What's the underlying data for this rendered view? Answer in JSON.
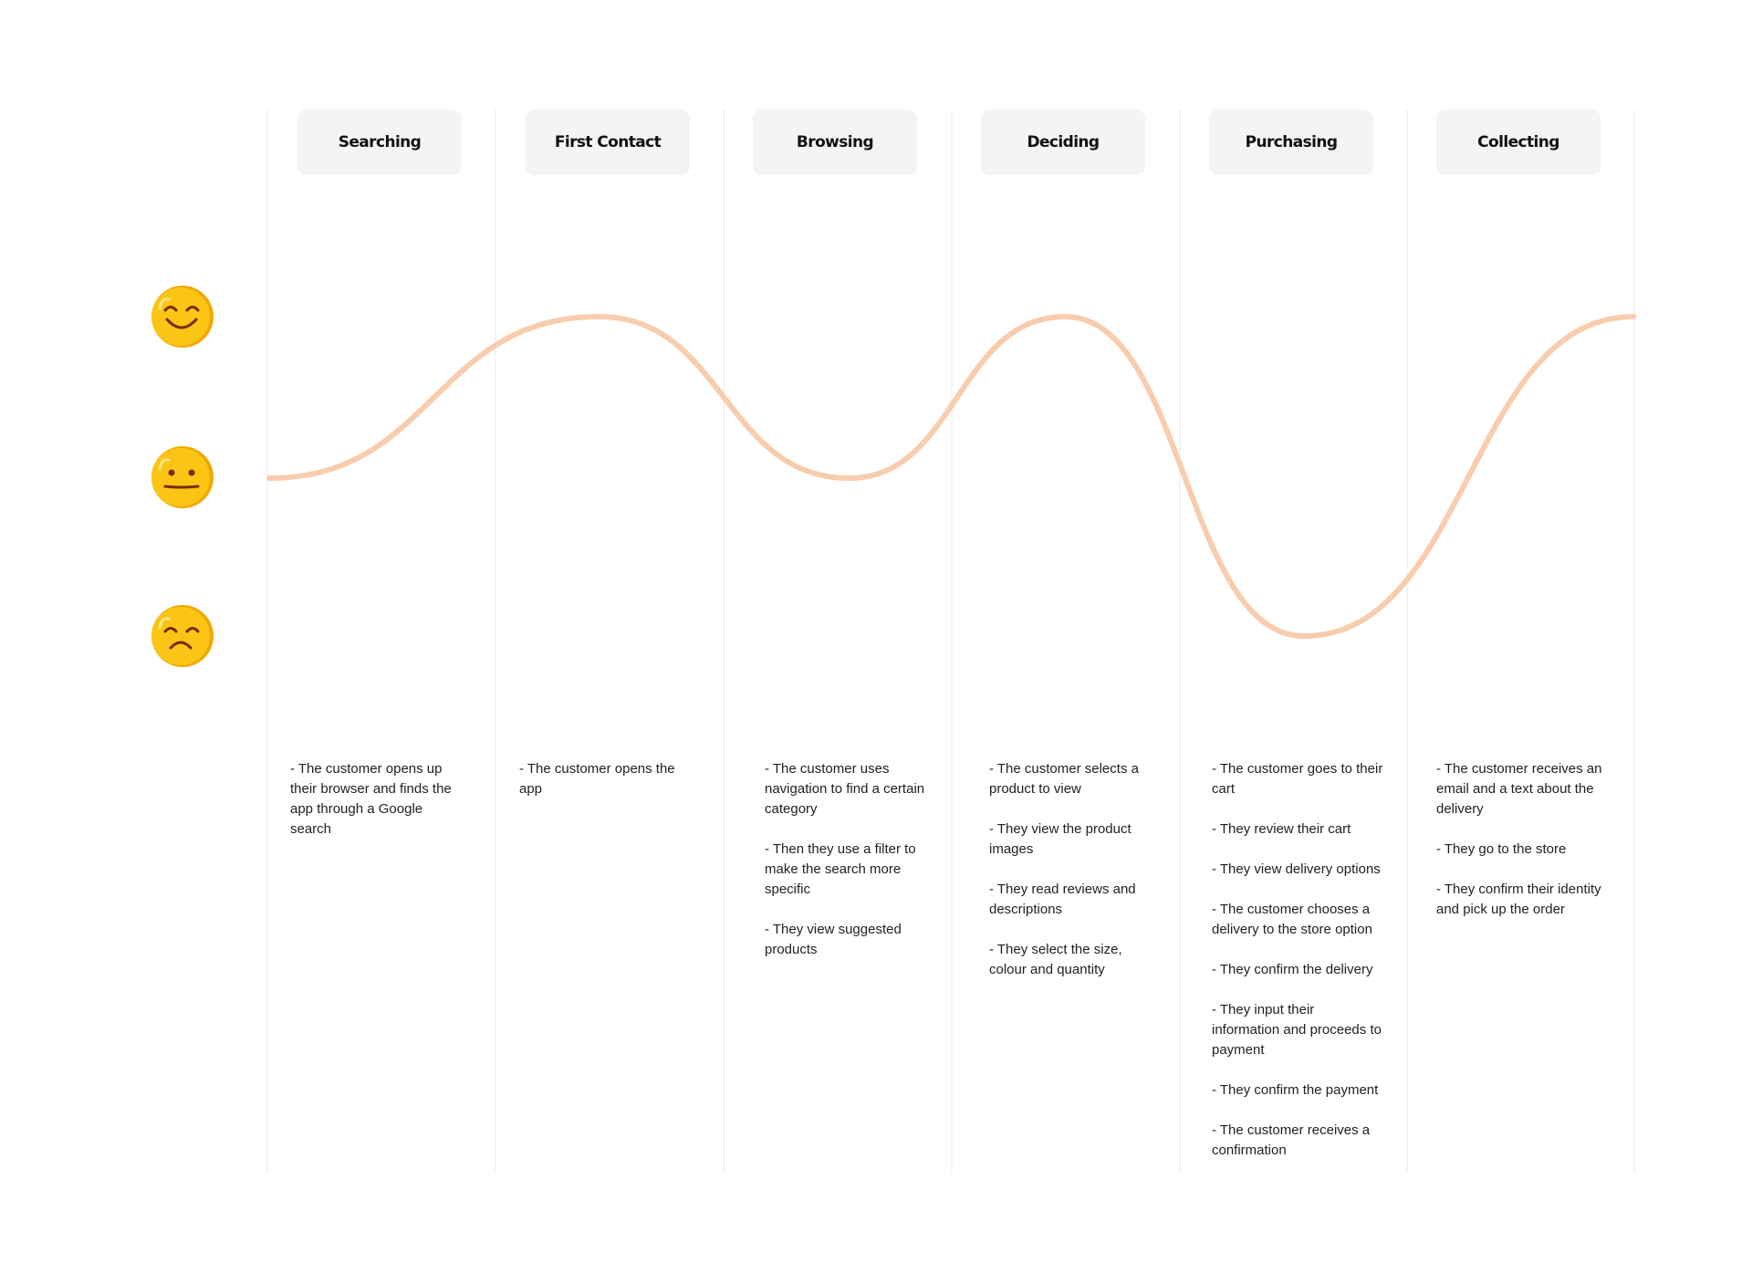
{
  "chart_data": {
    "type": "line",
    "title": "",
    "categories": [
      "Searching",
      "First Contact",
      "Browsing",
      "Deciding",
      "Purchasing",
      "Collecting"
    ],
    "y_levels": [
      "happy",
      "neutral",
      "sad"
    ],
    "series": [
      {
        "name": "Customer emotion",
        "color": "#f8ccad",
        "points": [
          {
            "x": 0.0,
            "level": "neutral"
          },
          {
            "x": 1.45,
            "level": "happy"
          },
          {
            "x": 2.55,
            "level": "neutral"
          },
          {
            "x": 3.5,
            "level": "happy"
          },
          {
            "x": 4.55,
            "level": "sad"
          },
          {
            "x": 6.0,
            "level": "happy"
          }
        ]
      }
    ],
    "legend": "left (emoji scale)"
  },
  "emotions": [
    {
      "name": "happy",
      "icon": "smiling-face-icon"
    },
    {
      "name": "neutral",
      "icon": "neutral-face-icon"
    },
    {
      "name": "sad",
      "icon": "sad-face-icon"
    }
  ],
  "stages": [
    {
      "label": "Searching",
      "steps": [
        "- The customer opens up their browser and finds the app through a Google search"
      ]
    },
    {
      "label": "First Contact",
      "steps": [
        "- The customer opens the app"
      ]
    },
    {
      "label": "Browsing",
      "steps": [
        "- The customer uses navigation to find a certain category",
        "- Then they use a filter to make the search more specific",
        "- They view suggested products"
      ]
    },
    {
      "label": "Deciding",
      "steps": [
        "- The customer selects a product to view",
        "- They view the product images",
        "- They read reviews and descriptions",
        "- They select the size, colour and quantity"
      ]
    },
    {
      "label": "Purchasing",
      "steps": [
        "- The customer goes to their cart",
        "- They review their cart",
        "- They view delivery options",
        "- The customer chooses a delivery to the store option",
        "- They confirm the delivery",
        "- They input their information and proceeds to payment",
        "- They confirm the payment",
        "- The customer receives a confirmation"
      ]
    },
    {
      "label": "Collecting",
      "steps": [
        "- The customer receives an email and a text about the delivery",
        "- They go to the store",
        "- They confirm their identity and pick up the order"
      ]
    }
  ],
  "colors": {
    "curve": "#f8ccad",
    "stage_box": "#f3f4f6",
    "divider": "#f3f4f6",
    "emoji_face": "#fbc515",
    "emoji_features": "#7a2a0c"
  }
}
